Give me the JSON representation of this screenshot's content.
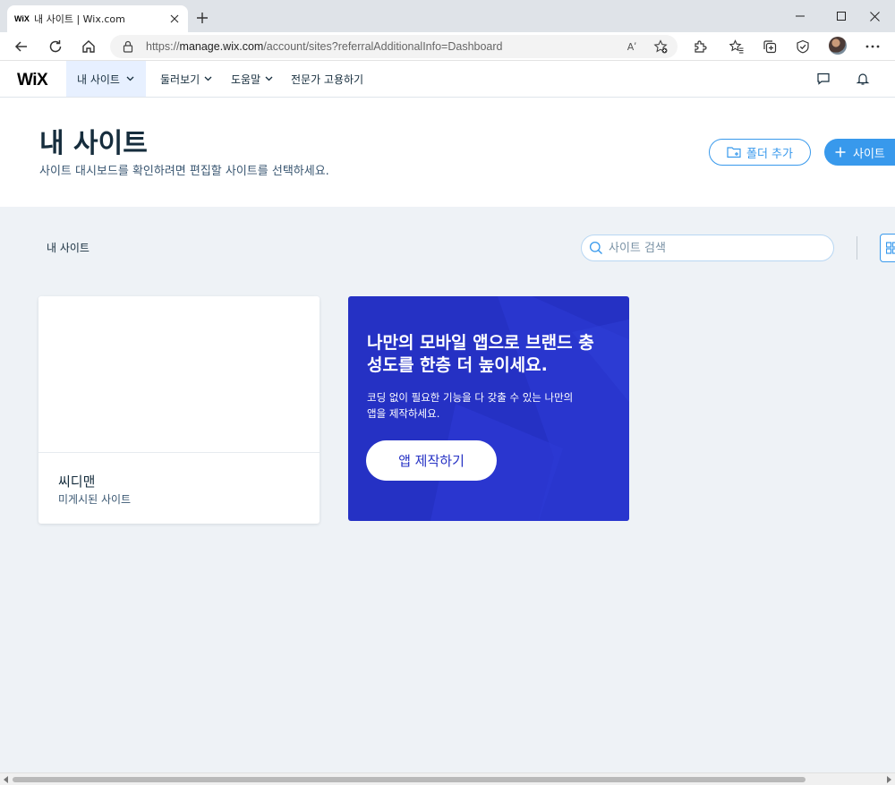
{
  "browser": {
    "tab": {
      "favicon_text": "WiX",
      "title": "내 사이트 | Wix.com"
    },
    "url": {
      "prefix": "https://",
      "host": "manage.wix.com",
      "path": "/account/sites?referralAdditionalInfo=Dashboard"
    },
    "read_aloud_glyph": "Aʹ"
  },
  "wix_nav": {
    "logo": "WiX",
    "items": [
      {
        "label": "내 사이트",
        "active": true
      },
      {
        "label": "둘러보기"
      },
      {
        "label": "도움말"
      },
      {
        "label": "전문가 고용하기"
      }
    ]
  },
  "header": {
    "title": "내 사이트",
    "subtitle": "사이트 대시보드를 확인하려면 편집할 사이트를 선택하세요.",
    "add_folder_label": "폴더 추가",
    "create_site_label": "사이트"
  },
  "content": {
    "section_label": "내 사이트",
    "search_placeholder": "사이트 검색",
    "sites": [
      {
        "name": "씨디맨",
        "status": "미게시된 사이트"
      }
    ],
    "promo": {
      "title": "나만의 모바일 앱으로 브랜드 충성도를 한층 더 높이세요.",
      "description": "코딩 없이 필요한 기능을 다 갖출 수 있는 나만의 앱을 제작하세요.",
      "button_label": "앱 제작하기"
    }
  },
  "colors": {
    "accent": "#3899ec",
    "promo_bg": "#2531c4",
    "page_bg": "#eef2f6",
    "text": "#162d3d"
  }
}
